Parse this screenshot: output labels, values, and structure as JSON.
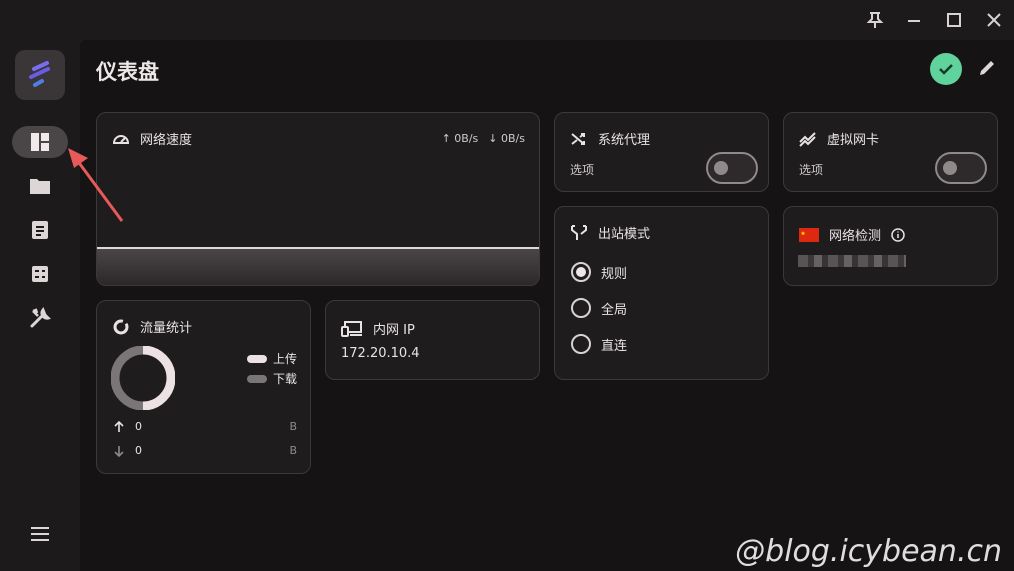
{
  "window": {
    "controls": [
      "pin-icon",
      "minimize-icon",
      "maximize-icon",
      "close-icon"
    ]
  },
  "sidebar": {
    "items": [
      {
        "icon": "dashboard-icon",
        "active": true
      },
      {
        "icon": "folder-icon",
        "active": false
      },
      {
        "icon": "rules-icon",
        "active": false
      },
      {
        "icon": "connections-icon",
        "active": false
      },
      {
        "icon": "tools-icon",
        "active": false
      }
    ],
    "menu_icon": "menu-icon"
  },
  "header": {
    "title": "仪表盘"
  },
  "cards": {
    "speed": {
      "title": "网络速度",
      "upload": "↑ 0B/s",
      "download": "↓ 0B/s"
    },
    "proxy": {
      "title": "系统代理",
      "option_label": "选项",
      "enabled": false
    },
    "tun": {
      "title": "虚拟网卡",
      "option_label": "选项",
      "enabled": false
    },
    "outbound": {
      "title": "出站模式",
      "options": [
        "规则",
        "全局",
        "直连"
      ],
      "selected": "规则"
    },
    "check": {
      "title": "网络检测"
    },
    "traffic": {
      "title": "流量统计",
      "legend_up": "上传",
      "legend_down": "下载",
      "up_value": "0",
      "down_value": "0",
      "up_unit": "B",
      "down_unit": "B"
    },
    "intranet": {
      "title": "内网 IP",
      "ip": "172.20.10.4"
    }
  },
  "watermark": "@blog.icybean.cn",
  "colors": {
    "accent_ok": "#5fd39b",
    "upload": "#ece1e3",
    "download": "#7a7576",
    "annotation_arrow": "#e85a5a"
  }
}
